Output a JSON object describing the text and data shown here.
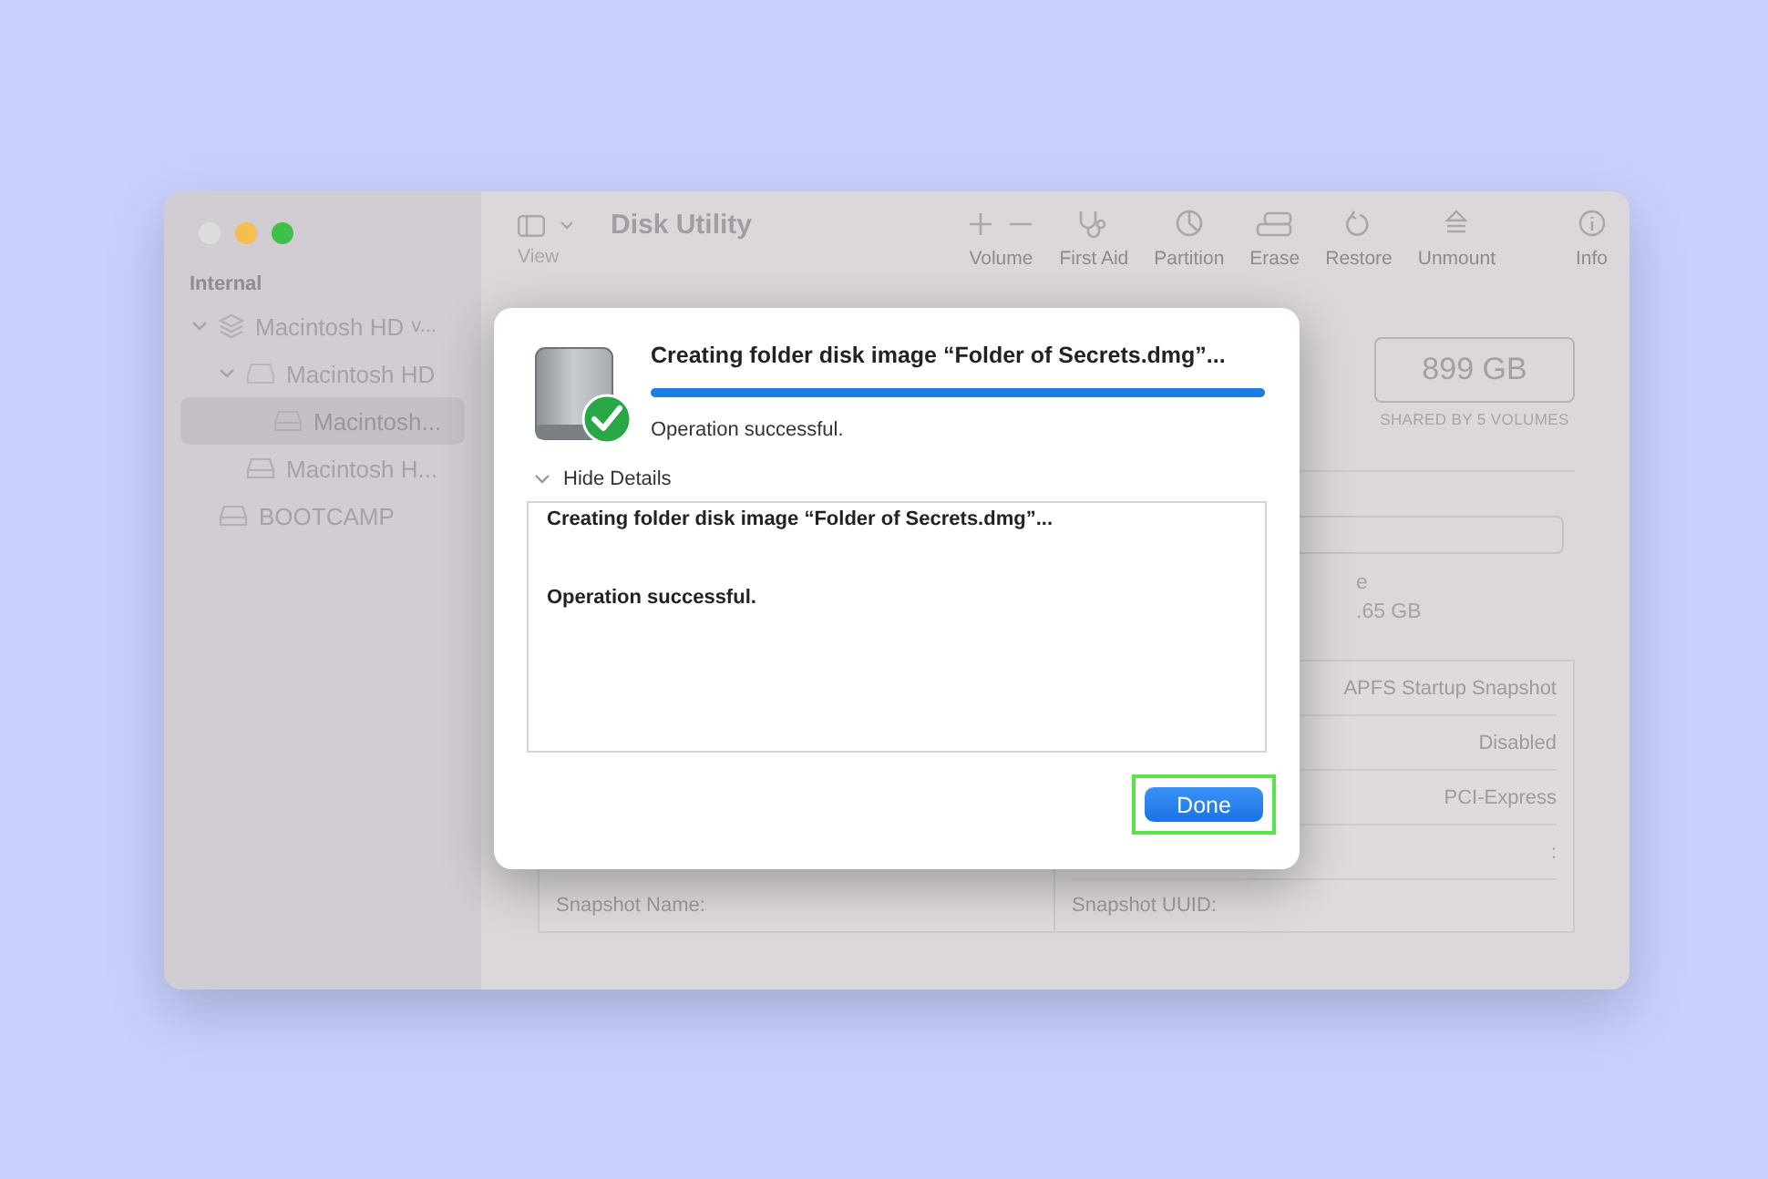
{
  "window": {
    "title": "Disk Utility",
    "traffic_lights": [
      {
        "color": "#dedcde"
      },
      {
        "color": "#f5be4f"
      },
      {
        "color": "#3ec04a"
      }
    ]
  },
  "toolbar": {
    "view_label": "View",
    "buttons": [
      {
        "label": "Volume",
        "kind": "plusminus"
      },
      {
        "label": "First Aid",
        "kind": "stethoscope"
      },
      {
        "label": "Partition",
        "kind": "pie"
      },
      {
        "label": "Erase",
        "kind": "eraser"
      },
      {
        "label": "Restore",
        "kind": "restore"
      },
      {
        "label": "Unmount",
        "kind": "eject"
      },
      {
        "label": "Info",
        "kind": "info"
      }
    ]
  },
  "sidebar": {
    "section": "Internal",
    "items": [
      {
        "label": "Macintosh HD",
        "suffix": "v...",
        "kind": "stack",
        "expanded": true,
        "selected": false,
        "children": [
          {
            "label": "Macintosh HD",
            "kind": "faint",
            "expanded": true,
            "selected": false,
            "children": [
              {
                "label": "Macintosh...",
                "kind": "drive",
                "selected": true
              }
            ]
          },
          {
            "label": "Macintosh H...",
            "kind": "drive",
            "selected": false
          }
        ]
      },
      {
        "label": "BOOTCAMP",
        "kind": "drive",
        "selected": false
      }
    ]
  },
  "capacity": {
    "value": "899 GB",
    "caption": "SHARED BY 5 VOLUMES"
  },
  "partial_texts": [
    "e",
    ".65 GB"
  ],
  "info_rows": [
    {
      "value": "APFS Startup Snapshot"
    },
    {
      "value": "Disabled"
    },
    {
      "value": "PCI-Express"
    },
    {
      "value": ":"
    }
  ],
  "info_footer": [
    {
      "label": "Snapshot Name:"
    },
    {
      "label": "Snapshot UUID:"
    }
  ],
  "dialog": {
    "title": "Creating folder disk image “Folder of Secrets.dmg”...",
    "level": 1,
    "status": "Operation successful.",
    "details_toggle": {
      "label": "Hide Details",
      "expanded": true
    },
    "details": [
      "Creating folder disk image “Folder of Secrets.dmg”...",
      "Operation successful."
    ],
    "done": {
      "label": "Done",
      "highlighted": true
    }
  }
}
